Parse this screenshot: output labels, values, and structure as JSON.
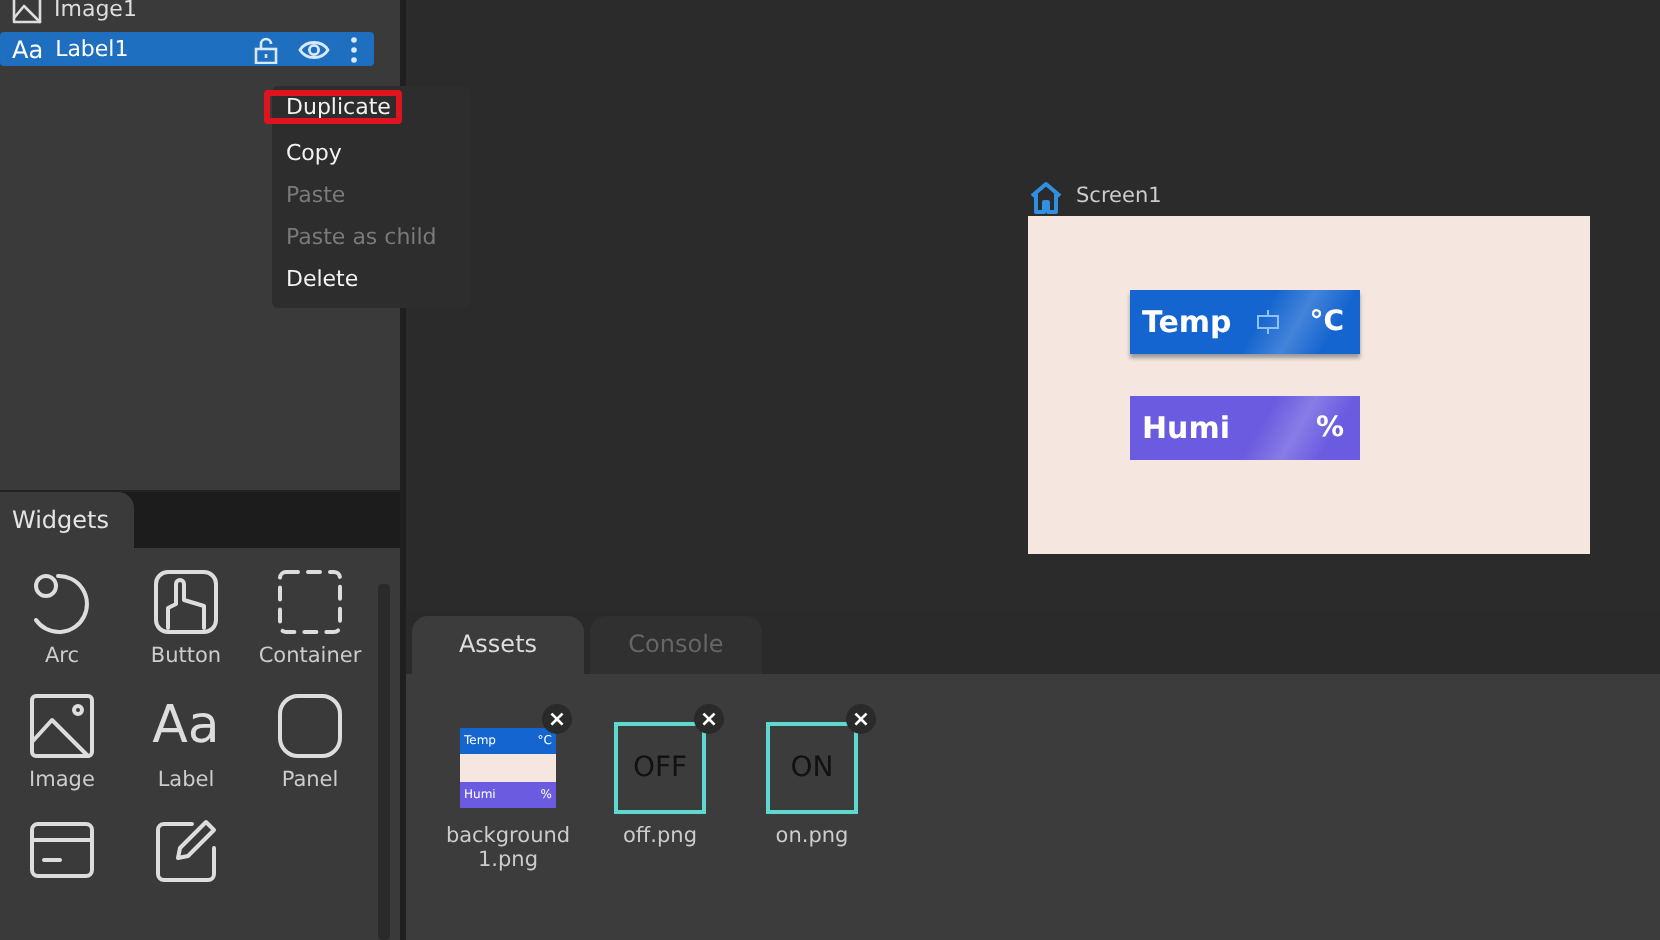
{
  "tree": {
    "items": [
      {
        "label": "Image1",
        "kind": "image",
        "selected": false
      },
      {
        "label": "Label1",
        "kind": "label",
        "icon": "Aa",
        "selected": true
      }
    ]
  },
  "context_menu": {
    "items": [
      {
        "label": "Duplicate",
        "disabled": false,
        "highlighted": true
      },
      {
        "label": "Copy",
        "disabled": false,
        "highlighted": false
      },
      {
        "label": "Paste",
        "disabled": true,
        "highlighted": false
      },
      {
        "label": "Paste as child",
        "disabled": true,
        "highlighted": false
      },
      {
        "label": "Delete",
        "disabled": false,
        "highlighted": false
      }
    ]
  },
  "widgets_panel": {
    "tabs": [
      {
        "label": "Widgets",
        "selected": true
      }
    ],
    "items": [
      {
        "label": "Arc",
        "kind": "arc"
      },
      {
        "label": "Button",
        "kind": "button"
      },
      {
        "label": "Container",
        "kind": "container"
      },
      {
        "label": "Image",
        "kind": "image"
      },
      {
        "label": "Label",
        "kind": "label",
        "icon": "Aa"
      },
      {
        "label": "Panel",
        "kind": "panel"
      },
      {
        "kind": "card"
      },
      {
        "kind": "edit"
      }
    ]
  },
  "canvas": {
    "screen_name": "Screen1",
    "widgets": [
      {
        "label": "Temp",
        "unit": "°C",
        "kind": "temp",
        "color": "#1565d0"
      },
      {
        "label": "Humi",
        "unit": "%",
        "kind": "humi",
        "color": "#6a5be0"
      }
    ]
  },
  "bottom_panel": {
    "tabs": [
      {
        "label": "Assets",
        "selected": true
      },
      {
        "label": "Console",
        "selected": false
      }
    ],
    "assets": [
      {
        "name": "background1.png",
        "kind": "image",
        "texts": [
          "Temp",
          "°C",
          "Humi",
          "%"
        ],
        "remove": "×"
      },
      {
        "name": "off.png",
        "kind": "text",
        "texts": [
          "OFF"
        ],
        "remove": "×"
      },
      {
        "name": "on.png",
        "kind": "text",
        "texts": [
          "ON"
        ],
        "remove": "×"
      }
    ]
  }
}
